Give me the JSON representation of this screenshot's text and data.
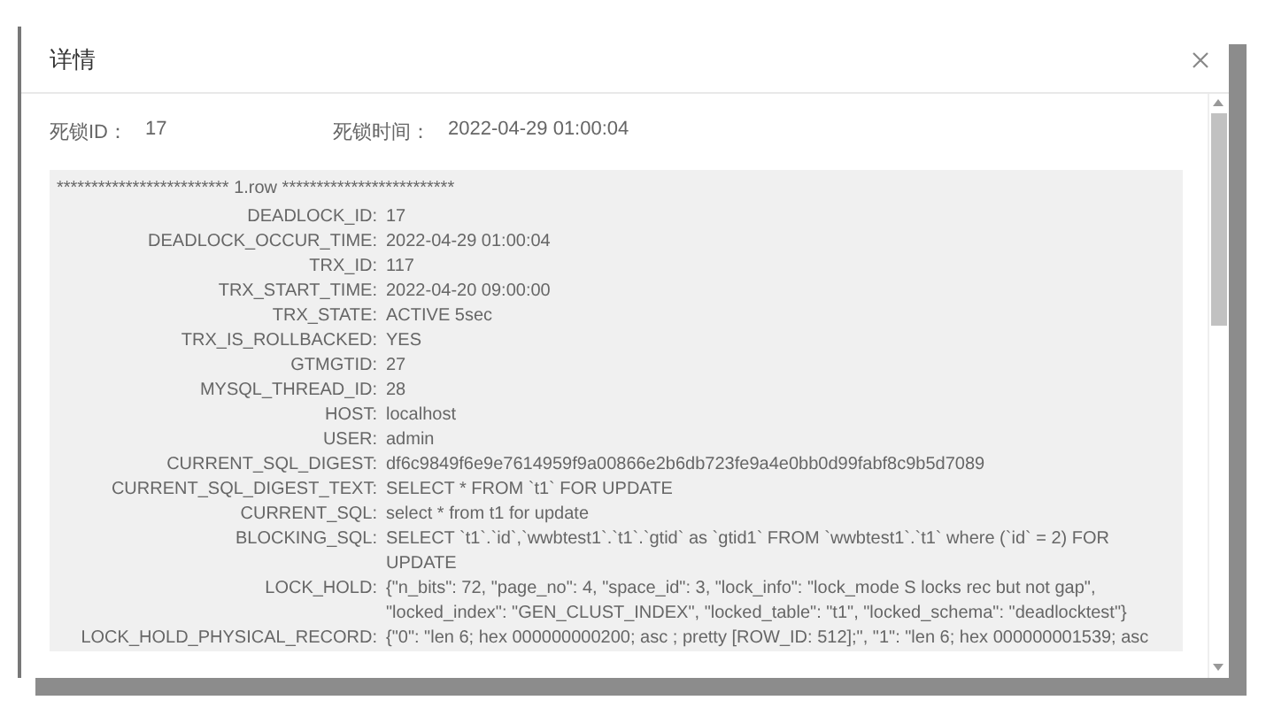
{
  "dialog": {
    "title": "详情",
    "summary": [
      {
        "label": "死锁ID：",
        "value": "17"
      },
      {
        "label": "死锁时间：",
        "value": "2022-04-29 01:00:04"
      }
    ],
    "detail": {
      "header": "************************* 1.row *************************",
      "fields": [
        {
          "label": "DEADLOCK_ID:",
          "value": "17"
        },
        {
          "label": "DEADLOCK_OCCUR_TIME:",
          "value": "2022-04-29 01:00:04"
        },
        {
          "label": "TRX_ID:",
          "value": "117"
        },
        {
          "label": "TRX_START_TIME:",
          "value": "2022-04-20 09:00:00"
        },
        {
          "label": "TRX_STATE:",
          "value": "ACTIVE 5sec"
        },
        {
          "label": "TRX_IS_ROLLBACKED:",
          "value": "YES"
        },
        {
          "label": "GTMGTID:",
          "value": "27"
        },
        {
          "label": "MYSQL_THREAD_ID:",
          "value": "28"
        },
        {
          "label": "HOST:",
          "value": "localhost"
        },
        {
          "label": "USER:",
          "value": "admin"
        },
        {
          "label": "CURRENT_SQL_DIGEST:",
          "value": "df6c9849f6e9e7614959f9a00866e2b6db723fe9a4e0bb0d99fabf8c9b5d7089"
        },
        {
          "label": "CURRENT_SQL_DIGEST_TEXT:",
          "value": "SELECT * FROM `t1` FOR UPDATE"
        },
        {
          "label": "CURRENT_SQL:",
          "value": "select * from t1 for update"
        },
        {
          "label": "BLOCKING_SQL:",
          "value": "SELECT `t1`.`id`,`wwbtest1`.`t1`.`gtid` as `gtid1` FROM `wwbtest1`.`t1` where (`id` = 2) FOR UPDATE"
        },
        {
          "label": "LOCK_HOLD:",
          "value": "{\"n_bits\": 72, \"page_no\": 4, \"space_id\": 3, \"lock_info\": \"lock_mode S locks rec but not gap\", \"locked_index\": \"GEN_CLUST_INDEX\", \"locked_table\": \"t1\", \"locked_schema\": \"deadlocktest\"}"
        },
        {
          "label": "LOCK_HOLD_PHYSICAL_RECORD:",
          "value": "{\"0\": \"len 6; hex 000000000200; asc ; pretty [ROW_ID: 512];\", \"1\": \"len 6; hex 000000001539; asc"
        }
      ]
    }
  }
}
